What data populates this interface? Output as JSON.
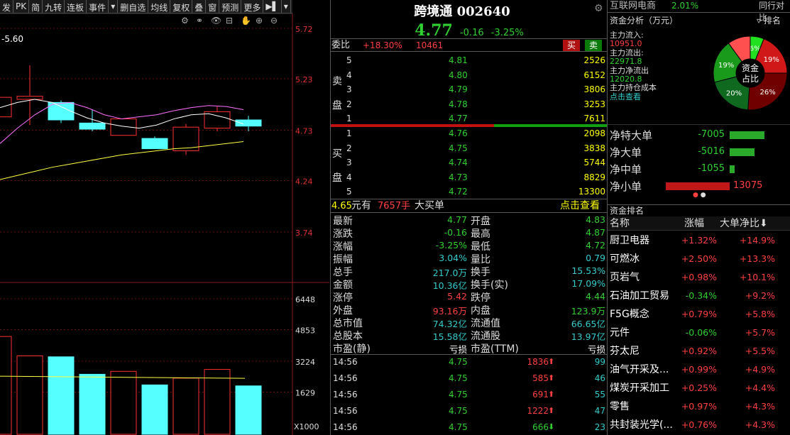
{
  "toolbar": [
    "发",
    "PK",
    "简",
    "九转",
    "连板",
    "事件",
    "▾",
    "删自选",
    "均线",
    "复权",
    "叠",
    "窗",
    "预测",
    "更多",
    "▶▌",
    "▾"
  ],
  "chart": {
    "ma_label": "-5.60",
    "price_ticks": [
      "5.72",
      "5.23",
      "4.73",
      "4.24",
      "3.74"
    ],
    "vol_ticks": [
      "6448",
      "4853",
      "3224",
      "1629"
    ],
    "vol_unit": "X1000",
    "candles": [
      {
        "o": 5.05,
        "c": 4.86,
        "h": 5.3,
        "l": 4.8,
        "color": "red"
      },
      {
        "o": 5.03,
        "c": 5.06,
        "h": 5.36,
        "l": 4.78,
        "color": "red"
      },
      {
        "o": 5.0,
        "c": 4.83,
        "h": 5.02,
        "l": 4.8,
        "color": "cyan"
      },
      {
        "o": 4.8,
        "c": 4.74,
        "h": 4.93,
        "l": 4.72,
        "color": "cyan"
      },
      {
        "o": 4.84,
        "c": 4.68,
        "h": 4.84,
        "l": 4.68,
        "color": "red"
      },
      {
        "o": 4.65,
        "c": 4.55,
        "h": 4.67,
        "l": 4.55,
        "color": "cyan"
      },
      {
        "o": 4.76,
        "c": 4.53,
        "h": 4.79,
        "l": 4.49,
        "color": "red"
      },
      {
        "o": 4.75,
        "c": 4.91,
        "h": 4.96,
        "l": 4.72,
        "color": "red"
      },
      {
        "o": 4.83,
        "c": 4.77,
        "h": 4.87,
        "l": 4.72,
        "color": "cyan"
      }
    ],
    "volumes": [
      {
        "v": 4500,
        "color": "red"
      },
      {
        "v": 3500,
        "color": "red"
      },
      {
        "v": 3450,
        "color": "cyan"
      },
      {
        "v": 2550,
        "color": "cyan"
      },
      {
        "v": 2700,
        "color": "red"
      },
      {
        "v": 2000,
        "color": "cyan"
      },
      {
        "v": 2350,
        "color": "red"
      },
      {
        "v": 2800,
        "color": "red"
      },
      {
        "v": 1950,
        "color": "cyan"
      }
    ]
  },
  "stock": {
    "name": "跨境通",
    "code": "002640",
    "price": "4.77",
    "chg": "-0.16",
    "pct": "-3.25%"
  },
  "weibi": {
    "label": "委比",
    "pct": "+18.30%",
    "diff": "10461",
    "buy_btn": "买",
    "sell_btn": "卖"
  },
  "sell_label": [
    "卖",
    "盘"
  ],
  "buy_label": [
    "买",
    "盘"
  ],
  "sells": [
    {
      "n": "5",
      "p": "4.81",
      "v": "2526"
    },
    {
      "n": "4",
      "p": "4.80",
      "v": "6152"
    },
    {
      "n": "3",
      "p": "4.79",
      "v": "3806"
    },
    {
      "n": "2",
      "p": "4.78",
      "v": "3253"
    },
    {
      "n": "1",
      "p": "4.77",
      "v": "7611"
    }
  ],
  "buys": [
    {
      "n": "1",
      "p": "4.76",
      "v": "2098"
    },
    {
      "n": "2",
      "p": "4.75",
      "v": "3838"
    },
    {
      "n": "3",
      "p": "4.74",
      "v": "5744"
    },
    {
      "n": "4",
      "p": "4.73",
      "v": "8829"
    },
    {
      "n": "5",
      "p": "4.72",
      "v": "13300"
    }
  ],
  "bigorder": {
    "price": "4.65",
    "t1": "元有",
    "hands": "7657手",
    "t2": "大买单",
    "link": "点击查看"
  },
  "stats": [
    {
      "l1": "最新",
      "v1": "4.77",
      "c1": "grn",
      "l2": "开盘",
      "v2": "4.83",
      "c2": "grn"
    },
    {
      "l1": "涨跌",
      "v1": "-0.16",
      "c1": "grn",
      "l2": "最高",
      "v2": "4.87",
      "c2": "grn"
    },
    {
      "l1": "涨幅",
      "v1": "-3.25%",
      "c1": "grn",
      "l2": "最低",
      "v2": "4.72",
      "c2": "grn"
    },
    {
      "l1": "振幅",
      "v1": "3.04%",
      "c1": "cyan",
      "l2": "量比",
      "v2": "0.79",
      "c2": "cyan"
    },
    {
      "l1": "总手",
      "v1": "217.0万",
      "c1": "cyan",
      "l2": "换手",
      "v2": "15.53%",
      "c2": "cyan"
    },
    {
      "l1": "金额",
      "v1": "10.36亿",
      "c1": "cyan",
      "l2": "换手(实)",
      "v2": "17.09%",
      "c2": "cyan"
    },
    {
      "l1": "涨停",
      "v1": "5.42",
      "c1": "red",
      "l2": "跌停",
      "v2": "4.44",
      "c2": "grn"
    },
    {
      "l1": "外盘",
      "v1": "93.16万",
      "c1": "red",
      "l2": "内盘",
      "v2": "123.9万",
      "c2": "grn"
    },
    {
      "l1": "总市值",
      "v1": "74.32亿",
      "c1": "cyan",
      "l2": "流通值",
      "v2": "66.65亿",
      "c2": "cyan"
    },
    {
      "l1": "总股本",
      "v1": "15.58亿",
      "c1": "cyan",
      "l2": "流通股",
      "v2": "13.97亿",
      "c2": "cyan"
    },
    {
      "l1": "市盈(静)",
      "v1": "亏损",
      "c1": "wht",
      "l2": "市盈(TTM)",
      "v2": "亏损",
      "c2": "wht"
    }
  ],
  "ticks": [
    {
      "t": "14:56",
      "p": "4.75",
      "v": "1836",
      "d": "up",
      "n": "99"
    },
    {
      "t": "14:56",
      "p": "4.75",
      "v": "585",
      "d": "up",
      "n": "46"
    },
    {
      "t": "14:56",
      "p": "4.75",
      "v": "691",
      "d": "up",
      "n": "55"
    },
    {
      "t": "14:56",
      "p": "4.75",
      "v": "1222",
      "d": "up",
      "n": "47"
    },
    {
      "t": "14:56",
      "p": "4.75",
      "v": "666",
      "d": "down",
      "n": "23"
    }
  ],
  "sector": {
    "name": "互联网电商",
    "pct": "2.01%",
    "compare": "同行对比"
  },
  "fund": {
    "title": "资金分析（万元）",
    "rank": "排名",
    "in_label": "主力流入:",
    "in_val": "10951.0",
    "out_label": "主力流出:",
    "out_val": "22971.8",
    "net_label": "主力净流出",
    "net_val": "12020.8",
    "cost_label": "主力持仓成本",
    "cost_link": "点击查看",
    "donut_center": [
      "资金",
      "占比"
    ],
    "slices": [
      {
        "label": "6%",
        "value": 6,
        "color": "#20e020"
      },
      {
        "label": "19%",
        "value": 19,
        "color": "#d01818"
      },
      {
        "label": "26%",
        "value": 26,
        "color": "#700000"
      },
      {
        "label": "20%",
        "value": 20,
        "color": "#0f6a20"
      },
      {
        "label": "19%",
        "value": 19,
        "color": "#1a9a1a"
      },
      {
        "label": "",
        "value": 10,
        "color": "#ff5050"
      }
    ]
  },
  "netflows": [
    {
      "label": "净特大单",
      "val": "-7005",
      "frac": 0.54,
      "color": "grn"
    },
    {
      "label": "净大单",
      "val": "-5016",
      "frac": 0.39,
      "color": "grn"
    },
    {
      "label": "净中单",
      "val": "-1055",
      "frac": 0.08,
      "color": "grn"
    },
    {
      "label": "净小单",
      "val": "13075",
      "frac": 1.0,
      "color": "red"
    }
  ],
  "rank": {
    "title": "资金排名",
    "col1": "名称",
    "col2": "涨幅",
    "col3": "大单净比",
    "rows": [
      {
        "n": "厨卫电器",
        "a": "+1.32%",
        "b": "+14.9%"
      },
      {
        "n": "可燃冰",
        "a": "+2.50%",
        "b": "+13.3%"
      },
      {
        "n": "页岩气",
        "a": "+0.98%",
        "b": "+10.1%"
      },
      {
        "n": "石油加工贸易",
        "a": "-0.34%",
        "b": "+9.2%"
      },
      {
        "n": "F5G概念",
        "a": "+0.79%",
        "b": "+5.8%"
      },
      {
        "n": "元件",
        "a": "-0.06%",
        "b": "+5.7%"
      },
      {
        "n": "芬太尼",
        "a": "+0.92%",
        "b": "+5.5%"
      },
      {
        "n": "油气开采及...",
        "a": "+0.99%",
        "b": "+4.9%"
      },
      {
        "n": "煤炭开采加工",
        "a": "+0.25%",
        "b": "+4.4%"
      },
      {
        "n": "零售",
        "a": "+0.97%",
        "b": "+4.3%"
      },
      {
        "n": "共封装光学(...",
        "a": "+0.76%",
        "b": "+4.3%"
      }
    ]
  }
}
